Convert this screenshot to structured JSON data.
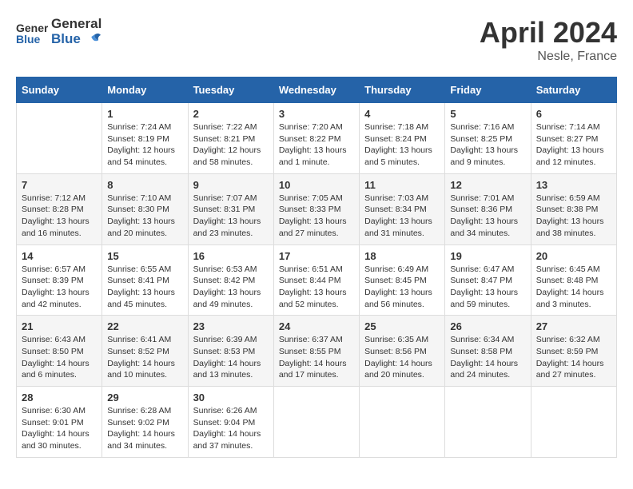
{
  "header": {
    "logo": {
      "general": "General",
      "blue": "Blue"
    },
    "title": "April 2024",
    "location": "Nesle, France"
  },
  "calendar": {
    "days_of_week": [
      "Sunday",
      "Monday",
      "Tuesday",
      "Wednesday",
      "Thursday",
      "Friday",
      "Saturday"
    ],
    "weeks": [
      [
        {
          "day": "",
          "info": ""
        },
        {
          "day": "1",
          "info": "Sunrise: 7:24 AM\nSunset: 8:19 PM\nDaylight: 12 hours\nand 54 minutes."
        },
        {
          "day": "2",
          "info": "Sunrise: 7:22 AM\nSunset: 8:21 PM\nDaylight: 12 hours\nand 58 minutes."
        },
        {
          "day": "3",
          "info": "Sunrise: 7:20 AM\nSunset: 8:22 PM\nDaylight: 13 hours\nand 1 minute."
        },
        {
          "day": "4",
          "info": "Sunrise: 7:18 AM\nSunset: 8:24 PM\nDaylight: 13 hours\nand 5 minutes."
        },
        {
          "day": "5",
          "info": "Sunrise: 7:16 AM\nSunset: 8:25 PM\nDaylight: 13 hours\nand 9 minutes."
        },
        {
          "day": "6",
          "info": "Sunrise: 7:14 AM\nSunset: 8:27 PM\nDaylight: 13 hours\nand 12 minutes."
        }
      ],
      [
        {
          "day": "7",
          "info": "Sunrise: 7:12 AM\nSunset: 8:28 PM\nDaylight: 13 hours\nand 16 minutes."
        },
        {
          "day": "8",
          "info": "Sunrise: 7:10 AM\nSunset: 8:30 PM\nDaylight: 13 hours\nand 20 minutes."
        },
        {
          "day": "9",
          "info": "Sunrise: 7:07 AM\nSunset: 8:31 PM\nDaylight: 13 hours\nand 23 minutes."
        },
        {
          "day": "10",
          "info": "Sunrise: 7:05 AM\nSunset: 8:33 PM\nDaylight: 13 hours\nand 27 minutes."
        },
        {
          "day": "11",
          "info": "Sunrise: 7:03 AM\nSunset: 8:34 PM\nDaylight: 13 hours\nand 31 minutes."
        },
        {
          "day": "12",
          "info": "Sunrise: 7:01 AM\nSunset: 8:36 PM\nDaylight: 13 hours\nand 34 minutes."
        },
        {
          "day": "13",
          "info": "Sunrise: 6:59 AM\nSunset: 8:38 PM\nDaylight: 13 hours\nand 38 minutes."
        }
      ],
      [
        {
          "day": "14",
          "info": "Sunrise: 6:57 AM\nSunset: 8:39 PM\nDaylight: 13 hours\nand 42 minutes."
        },
        {
          "day": "15",
          "info": "Sunrise: 6:55 AM\nSunset: 8:41 PM\nDaylight: 13 hours\nand 45 minutes."
        },
        {
          "day": "16",
          "info": "Sunrise: 6:53 AM\nSunset: 8:42 PM\nDaylight: 13 hours\nand 49 minutes."
        },
        {
          "day": "17",
          "info": "Sunrise: 6:51 AM\nSunset: 8:44 PM\nDaylight: 13 hours\nand 52 minutes."
        },
        {
          "day": "18",
          "info": "Sunrise: 6:49 AM\nSunset: 8:45 PM\nDaylight: 13 hours\nand 56 minutes."
        },
        {
          "day": "19",
          "info": "Sunrise: 6:47 AM\nSunset: 8:47 PM\nDaylight: 13 hours\nand 59 minutes."
        },
        {
          "day": "20",
          "info": "Sunrise: 6:45 AM\nSunset: 8:48 PM\nDaylight: 14 hours\nand 3 minutes."
        }
      ],
      [
        {
          "day": "21",
          "info": "Sunrise: 6:43 AM\nSunset: 8:50 PM\nDaylight: 14 hours\nand 6 minutes."
        },
        {
          "day": "22",
          "info": "Sunrise: 6:41 AM\nSunset: 8:52 PM\nDaylight: 14 hours\nand 10 minutes."
        },
        {
          "day": "23",
          "info": "Sunrise: 6:39 AM\nSunset: 8:53 PM\nDaylight: 14 hours\nand 13 minutes."
        },
        {
          "day": "24",
          "info": "Sunrise: 6:37 AM\nSunset: 8:55 PM\nDaylight: 14 hours\nand 17 minutes."
        },
        {
          "day": "25",
          "info": "Sunrise: 6:35 AM\nSunset: 8:56 PM\nDaylight: 14 hours\nand 20 minutes."
        },
        {
          "day": "26",
          "info": "Sunrise: 6:34 AM\nSunset: 8:58 PM\nDaylight: 14 hours\nand 24 minutes."
        },
        {
          "day": "27",
          "info": "Sunrise: 6:32 AM\nSunset: 8:59 PM\nDaylight: 14 hours\nand 27 minutes."
        }
      ],
      [
        {
          "day": "28",
          "info": "Sunrise: 6:30 AM\nSunset: 9:01 PM\nDaylight: 14 hours\nand 30 minutes."
        },
        {
          "day": "29",
          "info": "Sunrise: 6:28 AM\nSunset: 9:02 PM\nDaylight: 14 hours\nand 34 minutes."
        },
        {
          "day": "30",
          "info": "Sunrise: 6:26 AM\nSunset: 9:04 PM\nDaylight: 14 hours\nand 37 minutes."
        },
        {
          "day": "",
          "info": ""
        },
        {
          "day": "",
          "info": ""
        },
        {
          "day": "",
          "info": ""
        },
        {
          "day": "",
          "info": ""
        }
      ]
    ]
  }
}
